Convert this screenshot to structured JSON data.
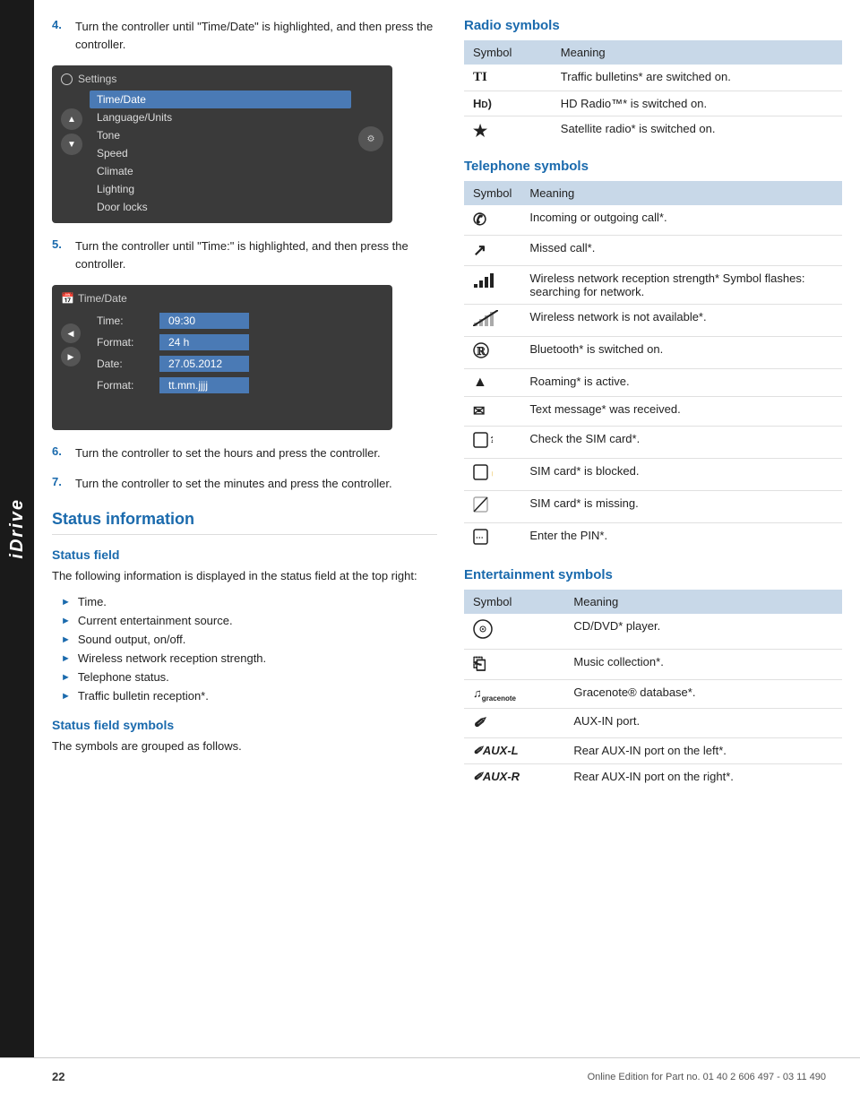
{
  "sidebar": {
    "label": "iDrive"
  },
  "steps": [
    {
      "num": "4.",
      "text": "Turn the controller until \"Time/Date\" is highlighted, and then press the controller."
    },
    {
      "num": "5.",
      "text": "Turn the controller until \"Time:\" is highlighted, and then press the controller."
    },
    {
      "num": "6.",
      "text": "Turn the controller to set the hours and press the controller."
    },
    {
      "num": "7.",
      "text": "Turn the controller to set the minutes and press the controller."
    }
  ],
  "screenshot1": {
    "title": "Settings",
    "items": [
      "Time/Date",
      "Language/Units",
      "Tone",
      "Speed",
      "Climate",
      "Lighting",
      "Door locks"
    ],
    "selected": "Time/Date"
  },
  "screenshot2": {
    "title": "Time/Date",
    "rows": [
      {
        "label": "Time:",
        "value": "09:30"
      },
      {
        "label": "Format:",
        "value": "24 h"
      },
      {
        "label": "Date:",
        "value": "27.05.2012"
      },
      {
        "label": "Format:",
        "value": "tt.mm.jjjj"
      }
    ]
  },
  "status_info": {
    "section_title": "Status information",
    "sub_title": "Status field",
    "body": "The following information is displayed in the status field at the top right:",
    "bullets": [
      "Time.",
      "Current entertainment source.",
      "Sound output, on/off.",
      "Wireless network reception strength.",
      "Telephone status.",
      "Traffic bulletin reception*."
    ],
    "sub_title2": "Status field symbols",
    "body2": "The symbols are grouped as follows."
  },
  "radio_symbols": {
    "title": "Radio symbols",
    "col_symbol": "Symbol",
    "col_meaning": "Meaning",
    "rows": [
      {
        "symbol": "TI",
        "meaning": "Traffic bulletins* are switched on."
      },
      {
        "symbol": "HD)",
        "meaning": "HD Radio™* is switched on."
      },
      {
        "symbol": "★",
        "meaning": "Satellite radio* is switched on."
      }
    ]
  },
  "telephone_symbols": {
    "title": "Telephone symbols",
    "col_symbol": "Symbol",
    "col_meaning": "Meaning",
    "rows": [
      {
        "symbol": "☎",
        "meaning": "Incoming or outgoing call*."
      },
      {
        "symbol": "↗",
        "meaning": "Missed call*."
      },
      {
        "symbol": "▪|||",
        "meaning": "Wireless network reception strength* Symbol flashes: searching for network."
      },
      {
        "symbol": "▪|||̶",
        "meaning": "Wireless network is not available*."
      },
      {
        "symbol": "⊙",
        "meaning": "Bluetooth* is switched on."
      },
      {
        "symbol": "▲",
        "meaning": "Roaming* is active."
      },
      {
        "symbol": "✉",
        "meaning": "Text message* was received."
      },
      {
        "symbol": "▣ᶠ",
        "meaning": "Check the SIM card*."
      },
      {
        "symbol": "▣🔒",
        "meaning": "SIM card* is blocked."
      },
      {
        "symbol": "▣̶",
        "meaning": "SIM card* is missing."
      },
      {
        "symbol": "▣⋯",
        "meaning": "Enter the PIN*."
      }
    ]
  },
  "entertainment_symbols": {
    "title": "Entertainment symbols",
    "col_symbol": "Symbol",
    "col_meaning": "Meaning",
    "rows": [
      {
        "symbol": "◎",
        "meaning": "CD/DVD* player."
      },
      {
        "symbol": "⏏",
        "meaning": "Music collection*."
      },
      {
        "symbol": "♪gracenote",
        "meaning": "Gracenote® database*."
      },
      {
        "symbol": "✏",
        "meaning": "AUX-IN port."
      },
      {
        "symbol": "✏AUX-L",
        "meaning": "Rear AUX-IN port on the left*."
      },
      {
        "symbol": "✏AUX-R",
        "meaning": "Rear AUX-IN port on the right*."
      }
    ]
  },
  "footer": {
    "page": "22",
    "text": "Online Edition for Part no. 01 40 2 606 497 - 03 11 490"
  }
}
